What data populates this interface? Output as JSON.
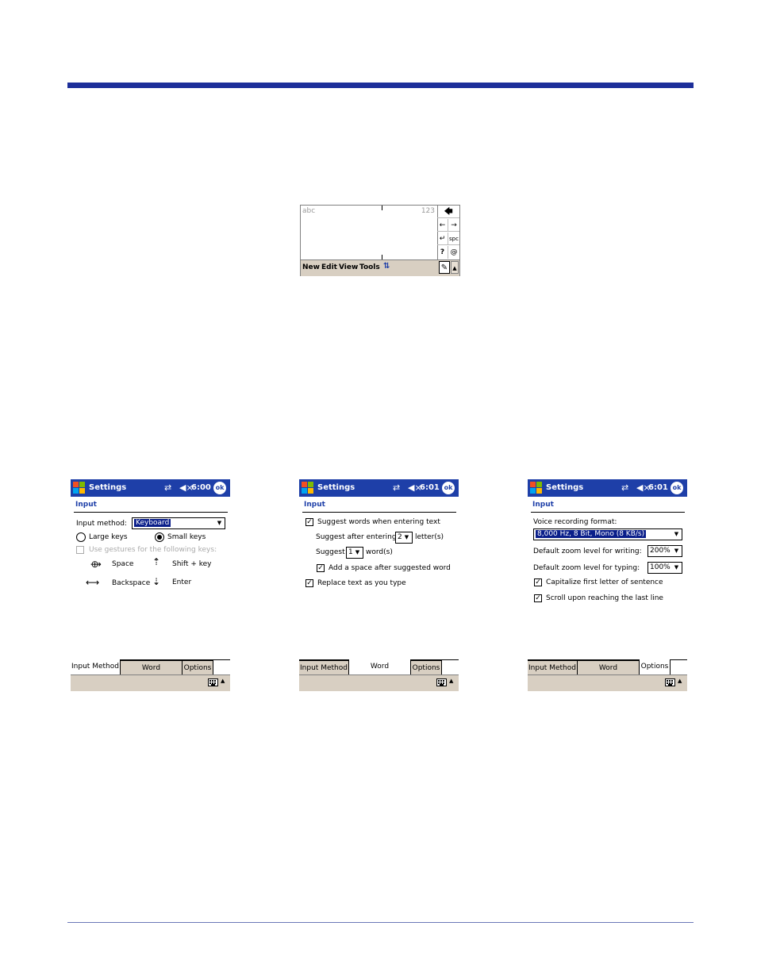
{
  "colors": {
    "accent": "#1d2f9a",
    "titlebar": "#1e3fa8",
    "menubar": "#d8cfc2",
    "selection": "#0a1e8a"
  },
  "transcriber": {
    "left_label": "abc",
    "right_label": "123",
    "keys": [
      "←",
      "→",
      "↵",
      "spc",
      "?",
      "@"
    ],
    "backspace_icon": "backspace-arrow-icon",
    "menus": [
      "New",
      "Edit",
      "View",
      "Tools"
    ],
    "pen_icon": "pen-icon",
    "up_icon": "up-arrow-icon"
  },
  "screens": [
    {
      "title": "Settings",
      "time": "6:00",
      "ok": "ok",
      "header": "Input",
      "input_method_label": "Input method:",
      "input_method_value": "Keyboard",
      "large_keys": "Large keys",
      "small_keys": "Small keys",
      "gestures_label": "Use gestures for the following keys:",
      "space": "Space",
      "shift_key": "Shift + key",
      "backspace": "Backspace",
      "enter": "Enter",
      "active_tab": 0
    },
    {
      "title": "Settings",
      "time": "6:01",
      "ok": "ok",
      "header": "Input",
      "suggest_words": "Suggest words when entering text",
      "suggest_after": "Suggest after entering",
      "letters_value": "2",
      "letters_label": "letter(s)",
      "suggest": "Suggest",
      "words_value": "1",
      "words_label": "word(s)",
      "add_space": "Add a space after suggested word",
      "replace_text": "Replace text as you type",
      "active_tab": 1
    },
    {
      "title": "Settings",
      "time": "6:01",
      "ok": "ok",
      "header": "Input",
      "voice_label": "Voice recording format:",
      "voice_value": "8,000 Hz, 8 Bit, Mono (8 KB/s)",
      "zoom_writing_label": "Default zoom level for writing:",
      "zoom_writing_value": "200%",
      "zoom_typing_label": "Default zoom level for typing:",
      "zoom_typing_value": "100%",
      "capitalize": "Capitalize first letter of sentence",
      "scroll": "Scroll upon reaching the last line",
      "active_tab": 2
    }
  ],
  "tabs": [
    "Input Method",
    "Word Completion",
    "Options"
  ]
}
